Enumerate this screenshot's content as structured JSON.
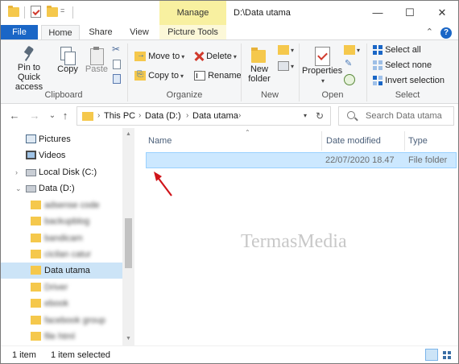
{
  "titlebar": {
    "context_group": "Manage",
    "path": "D:\\Data utama",
    "dropdown_glyph": "=",
    "minimize": "—",
    "maximize": "☐",
    "close": "✕"
  },
  "tabs": {
    "file": "File",
    "home": "Home",
    "share": "Share",
    "view": "View",
    "picture_tools": "Picture Tools",
    "collapse_glyph": "⌃",
    "help_glyph": "?"
  },
  "ribbon": {
    "clipboard": {
      "label": "Clipboard",
      "pin_to_quick_access": "Pin to Quick access",
      "copy": "Copy",
      "paste": "Paste"
    },
    "organize": {
      "label": "Organize",
      "move_to": "Move to",
      "copy_to": "Copy to",
      "delete": "Delete",
      "rename": "Rename"
    },
    "new": {
      "label": "New",
      "new_folder": "New folder"
    },
    "open": {
      "label": "Open",
      "properties": "Properties"
    },
    "select": {
      "label": "Select",
      "select_all": "Select all",
      "select_none": "Select none",
      "invert_selection": "Invert selection"
    }
  },
  "navigation": {
    "back": "←",
    "forward": "→",
    "recent": "⌄",
    "up": "↑",
    "breadcrumb": [
      "This PC",
      "Data (D:)",
      "Data utama"
    ],
    "refresh": "↻",
    "search_placeholder": "Search Data utama"
  },
  "nav_pane": {
    "items": [
      {
        "label": "Pictures"
      },
      {
        "label": "Videos"
      },
      {
        "label": "Local Disk (C:)"
      },
      {
        "label": "Data (D:)"
      },
      {
        "label": "adsense code"
      },
      {
        "label": "backupblog"
      },
      {
        "label": "bandicam"
      },
      {
        "label": "cicilan catur"
      },
      {
        "label": "Data utama"
      },
      {
        "label": "Driver"
      },
      {
        "label": "ebook"
      },
      {
        "label": "facebook group"
      },
      {
        "label": "file html"
      }
    ]
  },
  "content": {
    "columns": {
      "name": "Name",
      "date_modified": "Date modified",
      "type": "Type"
    },
    "rows": [
      {
        "name": "",
        "date_modified": "22/07/2020 18.47",
        "type": "File folder"
      }
    ],
    "watermark": "TermasMedia"
  },
  "status": {
    "item_count": "1 item",
    "selected_count": "1 item selected"
  },
  "colors": {
    "file_tab": "#1a66c6",
    "context_tab": "#f8f0a0",
    "selection": "#cce8ff",
    "folder": "#f5c84c",
    "annotation_arrow": "#d0141a"
  }
}
